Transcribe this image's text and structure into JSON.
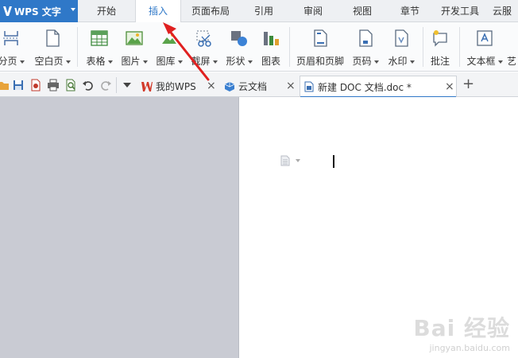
{
  "app": {
    "title": "WPS 文字",
    "brand_color": "#2f78c8"
  },
  "menu_tabs": [
    {
      "label": "开始",
      "active": false
    },
    {
      "label": "插入",
      "active": true
    },
    {
      "label": "页面布局",
      "active": false
    },
    {
      "label": "引用",
      "active": false
    },
    {
      "label": "审阅",
      "active": false
    },
    {
      "label": "视图",
      "active": false
    },
    {
      "label": "章节",
      "active": false
    },
    {
      "label": "开发工具",
      "active": false
    },
    {
      "label": "云服",
      "active": false
    }
  ],
  "ribbon": {
    "page_break": "分页",
    "blank_page": "空白页",
    "table": "表格",
    "picture": "图片",
    "gallery": "图库",
    "screenshot": "截屏",
    "shapes": "形状",
    "chart": "图表",
    "header_footer": "页眉和页脚",
    "page_number": "页码",
    "watermark": "水印",
    "comment": "批注",
    "text_box": "文本框",
    "art": "艺"
  },
  "quick_access_icons": [
    "open-icon",
    "save-icon",
    "export-pdf-icon",
    "print-icon",
    "print-preview-icon",
    "undo-icon",
    "redo-icon",
    "customize-icon"
  ],
  "doc_tabs": [
    {
      "label": "我的WPS",
      "active": false
    },
    {
      "label": "云文档",
      "active": false
    },
    {
      "label": "新建 DOC 文档.doc *",
      "active": true
    }
  ],
  "close_glyph": "×",
  "new_tab_glyph": "+",
  "watermark": {
    "brand": "Bai 经验",
    "url": "jingyan.baidu.com"
  },
  "annotation_color": "#e02020"
}
